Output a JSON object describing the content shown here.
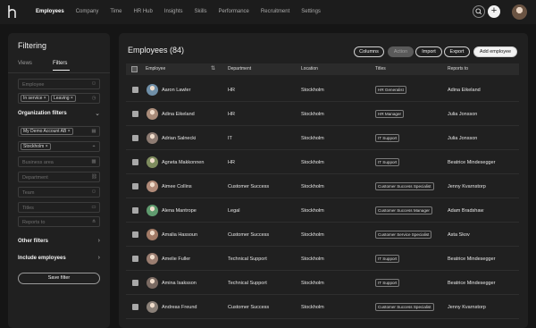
{
  "nav": {
    "items": [
      "Employees",
      "Company",
      "Time",
      "HR Hub",
      "Insights",
      "Skills",
      "Performance",
      "Recruitment",
      "Settings"
    ],
    "active": "Employees"
  },
  "sidebar": {
    "title": "Filtering",
    "tabs": [
      "Views",
      "Filters"
    ],
    "active_tab": "Filters",
    "employee_placeholder": "Employee",
    "employee_chips": [
      "In service",
      "Leaving"
    ],
    "org_filters_label": "Organization filters",
    "company_chip": "My Demo Account AB",
    "location_chip": "Stockholm",
    "fields": [
      "Business area",
      "Department",
      "Team",
      "Titles",
      "Reports to"
    ],
    "other_filters_label": "Other filters",
    "include_employees_label": "Include employees",
    "save_filter_label": "Save filter"
  },
  "main": {
    "title": "Employees (84)",
    "buttons": {
      "columns": "Columns",
      "action": "Action",
      "import": "Import",
      "export": "Export",
      "add": "Add employee"
    },
    "columns": [
      "Employee",
      "Department",
      "Location",
      "Titles",
      "Reports to"
    ],
    "rows": [
      {
        "name": "Aaron Lawler",
        "department": "HR",
        "location": "Stockholm",
        "title": "HR Generalist",
        "reports_to": "Adina Eikeland",
        "avatar_color": "#6f8fa8"
      },
      {
        "name": "Adina Eikeland",
        "department": "HR",
        "location": "Stockholm",
        "title": "HR Manager",
        "reports_to": "Julia Jonsson",
        "avatar_color": "#a98c7a"
      },
      {
        "name": "Adrian Salnecki",
        "department": "IT",
        "location": "Stockholm",
        "title": "IT Support",
        "reports_to": "Julia Jonsson",
        "avatar_color": "#8d7b72"
      },
      {
        "name": "Agneta Makkonnen",
        "department": "HR",
        "location": "Stockholm",
        "title": "IT Support",
        "reports_to": "Beatrice Mindesegger",
        "avatar_color": "#7e8c5e"
      },
      {
        "name": "Aimee Collins",
        "department": "Customer Success",
        "location": "Stockholm",
        "title": "Customer Success Specialist",
        "reports_to": "Jenny Kvarnstorp",
        "avatar_color": "#b08a78"
      },
      {
        "name": "Alena Mantrope",
        "department": "Legal",
        "location": "Stockholm",
        "title": "Customer Success Manager",
        "reports_to": "Adam Bradshaw",
        "avatar_color": "#5f9a6e"
      },
      {
        "name": "Amalia Hassoun",
        "department": "Customer Success",
        "location": "Stockholm",
        "title": "Customer Service Specialist",
        "reports_to": "Asta Skov",
        "avatar_color": "#a27a66"
      },
      {
        "name": "Amelie Fuller",
        "department": "Technical Support",
        "location": "Stockholm",
        "title": "IT Support",
        "reports_to": "Beatrice Mindesegger",
        "avatar_color": "#9a7d70"
      },
      {
        "name": "Amina Isaksson",
        "department": "Technical Support",
        "location": "Stockholm",
        "title": "IT Support",
        "reports_to": "Beatrice Mindesegger",
        "avatar_color": "#7a6a62"
      },
      {
        "name": "Andreas Freund",
        "department": "Customer Success",
        "location": "Stockholm",
        "title": "Customer Success Specialist",
        "reports_to": "Jenny Kvarnstorp",
        "avatar_color": "#8a8078"
      }
    ]
  }
}
